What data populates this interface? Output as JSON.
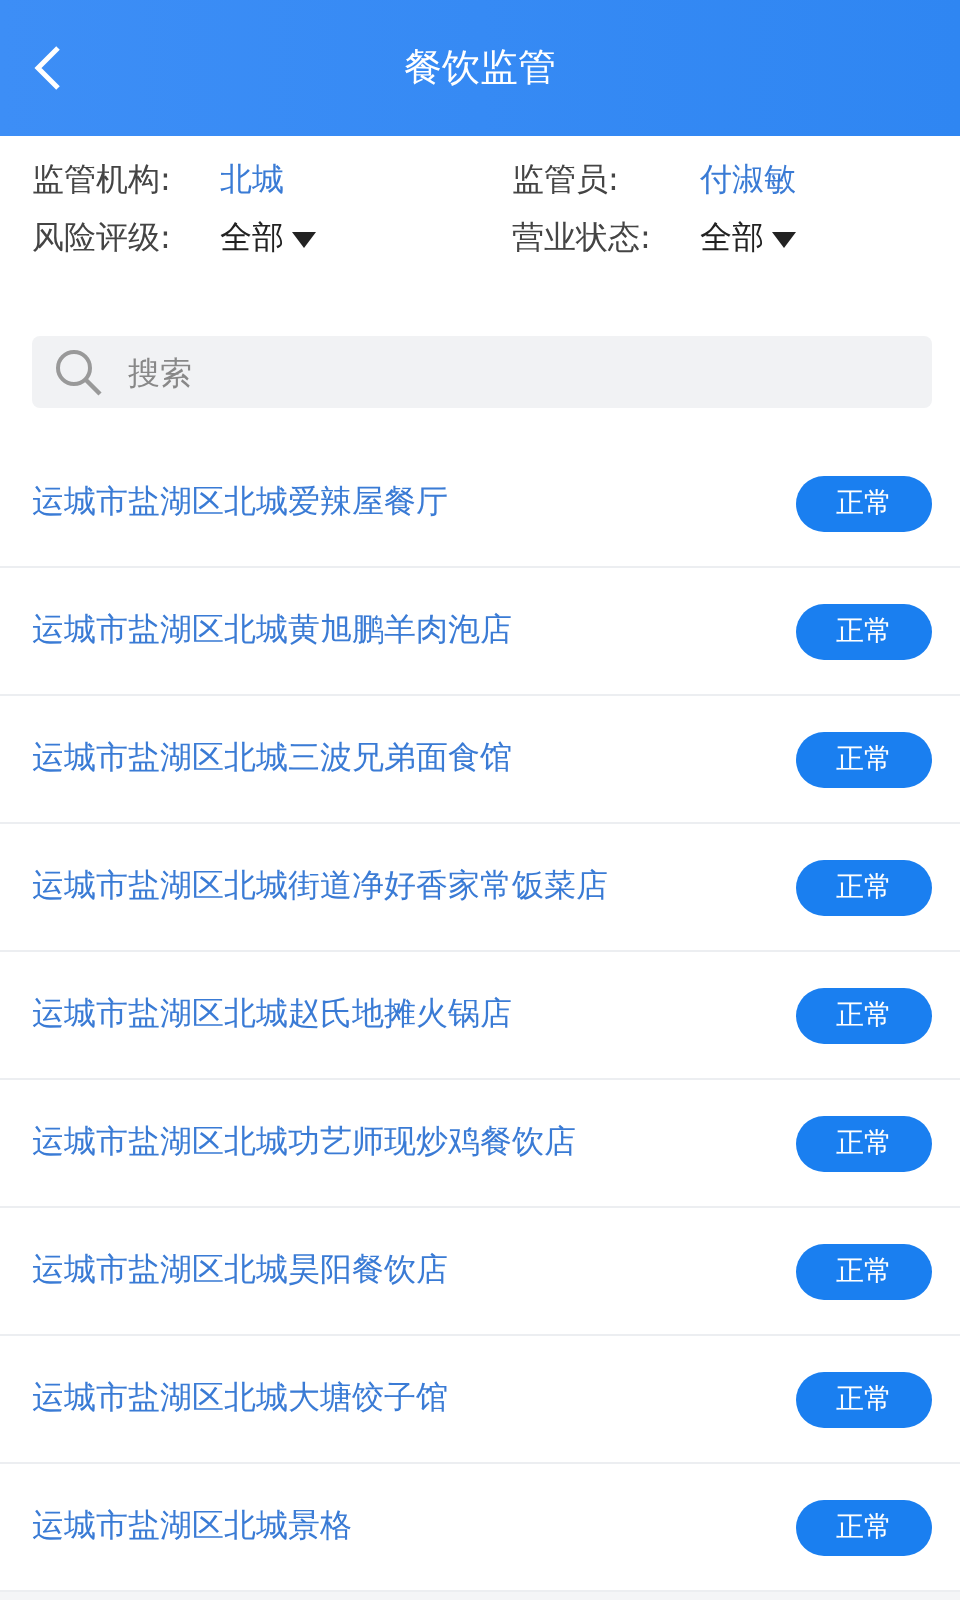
{
  "header": {
    "title": "餐饮监管"
  },
  "filters": [
    {
      "label": "监管机构:",
      "value": "北城",
      "kind": "link"
    },
    {
      "label": "监管员:",
      "value": "付淑敏",
      "kind": "link"
    },
    {
      "label": "风险评级:",
      "value": "全部",
      "kind": "dropdown"
    },
    {
      "label": "营业状态:",
      "value": "全部",
      "kind": "dropdown"
    }
  ],
  "search": {
    "placeholder": "搜索"
  },
  "rows": [
    {
      "name": "运城市盐湖区北城爱辣屋餐厅",
      "status": "正常"
    },
    {
      "name": "运城市盐湖区北城黄旭鹏羊肉泡店",
      "status": "正常"
    },
    {
      "name": "运城市盐湖区北城三波兄弟面食馆",
      "status": "正常"
    },
    {
      "name": "运城市盐湖区北城街道净好香家常饭菜店",
      "status": "正常"
    },
    {
      "name": "运城市盐湖区北城赵氏地摊火锅店",
      "status": "正常"
    },
    {
      "name": "运城市盐湖区北城功艺师现炒鸡餐饮店",
      "status": "正常"
    },
    {
      "name": "运城市盐湖区北城昊阳餐饮店",
      "status": "正常"
    },
    {
      "name": "运城市盐湖区北城大塘饺子馆",
      "status": "正常"
    },
    {
      "name": "运城市盐湖区北城景格",
      "status": "正常"
    }
  ]
}
